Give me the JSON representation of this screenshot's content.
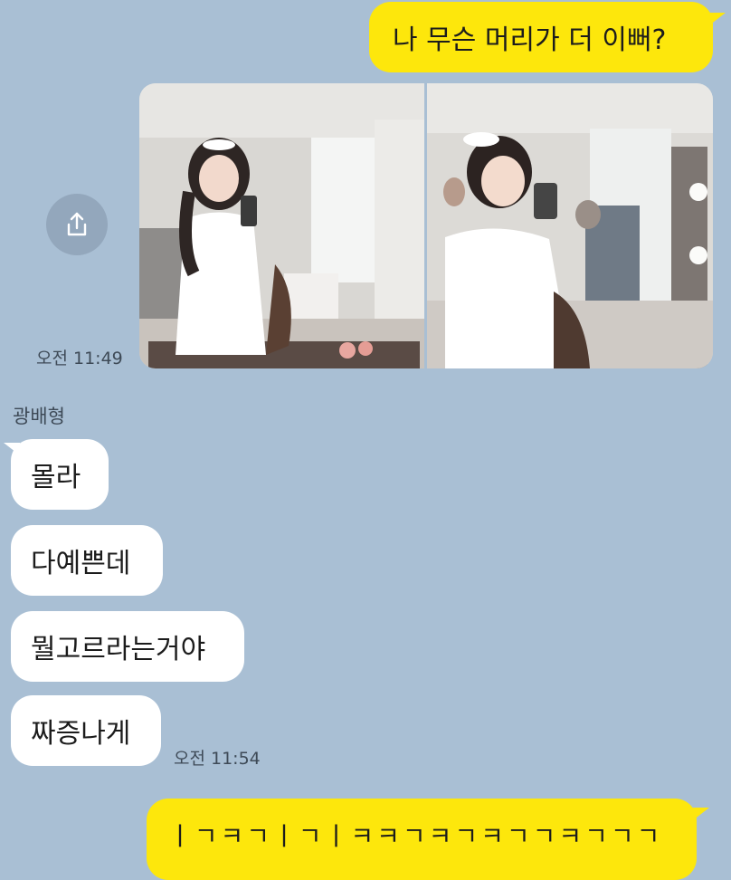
{
  "messages": {
    "m1": "나 무슨 머리가 더 이뻐?",
    "photo_time": "오전 11:49",
    "sender_name": "광배형",
    "r1": "몰라",
    "r2": "다예쁜데",
    "r3": "뭘고르라는거야",
    "r4": "짜증나게",
    "reply_time": "오전 11:54",
    "m2": "ㅣㄱㅋㄱㅣㄱㅣㅋㅋㄱㅋㄱㅋㄱㄱㅋㄱㄱㄱ"
  },
  "icons": {
    "share": "share-icon"
  },
  "colors": {
    "background": "#a9bfd4",
    "my_bubble": "#fde70c",
    "their_bubble": "#ffffff"
  }
}
